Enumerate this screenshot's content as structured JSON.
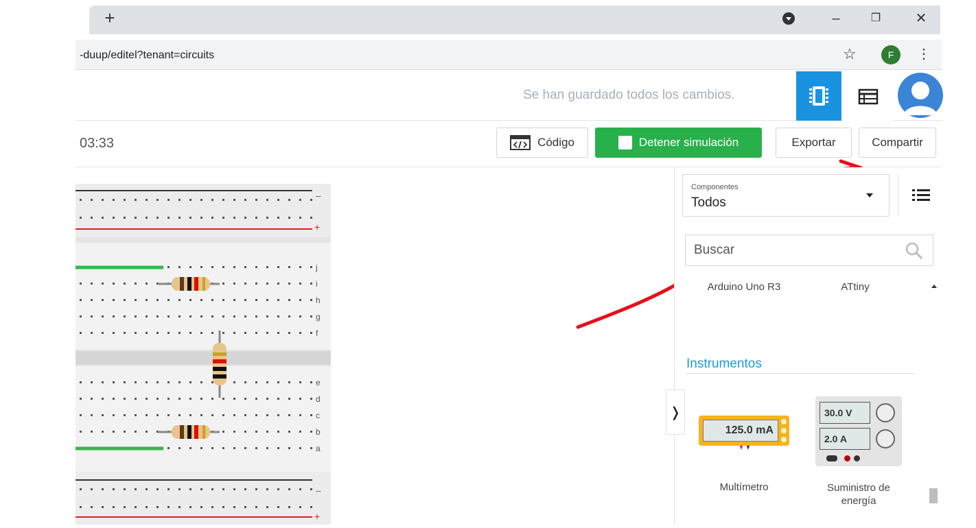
{
  "browser": {
    "new_tab_symbol": "+",
    "url": "-duup/editel?tenant=circuits",
    "profile_initial": "F",
    "window_controls": {
      "minimize": "–",
      "restore": "❐",
      "close": "✕"
    },
    "star_symbol": "☆",
    "menu_symbol": "⋮"
  },
  "header": {
    "save_status": "Se han guardado todos los cambios."
  },
  "toolbar": {
    "timer": "03:33",
    "code_label": "Código",
    "stop_simulation_label": "Detener simulación",
    "export_label": "Exportar",
    "share_label": "Compartir"
  },
  "sidebar": {
    "components_caption": "Componentes",
    "components_value": "Todos",
    "search_placeholder": "Buscar",
    "items_top": [
      "Arduino Uno R3",
      "ATtiny"
    ],
    "section_instruments": "Instrumentos",
    "multimeter_display": "125.0 mA",
    "multimeter_label": "Multímetro",
    "power_display_voltage": "30.0 V",
    "power_display_current": "2.0 A",
    "power_label": "Suministro de energía",
    "collapse_symbol": "❭"
  },
  "board": {
    "row_letters_top": [
      "j",
      "i",
      "h",
      "g",
      "f"
    ],
    "row_letters_bottom": [
      "e",
      "d",
      "c",
      "b",
      "a"
    ],
    "rail_minus": "–",
    "rail_plus": "+"
  },
  "colors": {
    "accent_blue": "#1993e0",
    "stop_green": "#28b04b",
    "annotation_red": "#e8101c"
  }
}
